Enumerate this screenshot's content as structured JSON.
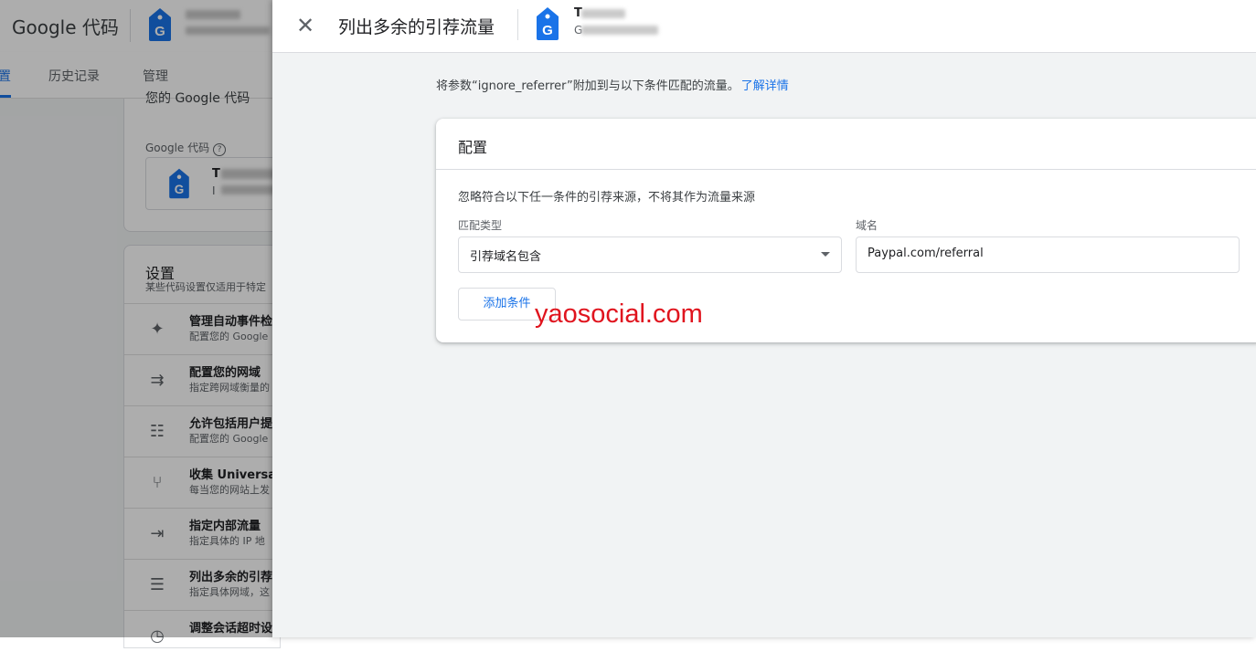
{
  "background": {
    "title": "Google 代码",
    "tabs": [
      {
        "label": "置"
      },
      {
        "label": "历史记录"
      },
      {
        "label": "管理"
      }
    ],
    "section_title_partial": "您的 Google 代码",
    "tag_label": "Google 代码",
    "tag_name_initial": "T",
    "tag_id_initial": "I",
    "settings_title": "设置",
    "settings_subtitle": "某些代码设置仅适用于特定",
    "settings": [
      {
        "icon": "sparkle-icon",
        "title": "管理自动事件检",
        "desc": "配置您的 Google"
      },
      {
        "icon": "merge-arrows-icon",
        "title": "配置您的网域",
        "desc": "指定跨网域衡量的"
      },
      {
        "icon": "id-card-icon",
        "title": "允许包括用户提",
        "desc": "配置您的 Google"
      },
      {
        "icon": "fork-icon",
        "title": "收集 Universal",
        "desc": "每当您的网站上发"
      },
      {
        "icon": "login-icon",
        "title": "指定内部流量",
        "desc": "指定具体的 IP 地"
      },
      {
        "icon": "list-check-icon",
        "title": "列出多余的引荐",
        "desc": "指定具体网域，这"
      },
      {
        "icon": "clock-icon",
        "title": "调整会话超时设",
        "desc": ""
      }
    ]
  },
  "panel": {
    "title": "列出多余的引荐流量",
    "tag_name_initial": "T",
    "tag_id_initial": "G",
    "intro": "将参数“ignore_referrer”附加到与以下条件匹配的流量。",
    "learn_more": "了解详情",
    "config_title": "配置",
    "config_desc": "忽略符合以下任一条件的引荐来源，不将其作为流量来源",
    "match_type_label": "匹配类型",
    "match_type_value": "引荐域名包含",
    "domain_label": "域名",
    "domain_value": "Paypal.com/referral",
    "add_condition": "添加条件"
  },
  "watermark": "yaosocial.com",
  "colors": {
    "accent": "#1a73e8",
    "watermark": "#e0141e",
    "tag_icon": "#1a73e8"
  }
}
